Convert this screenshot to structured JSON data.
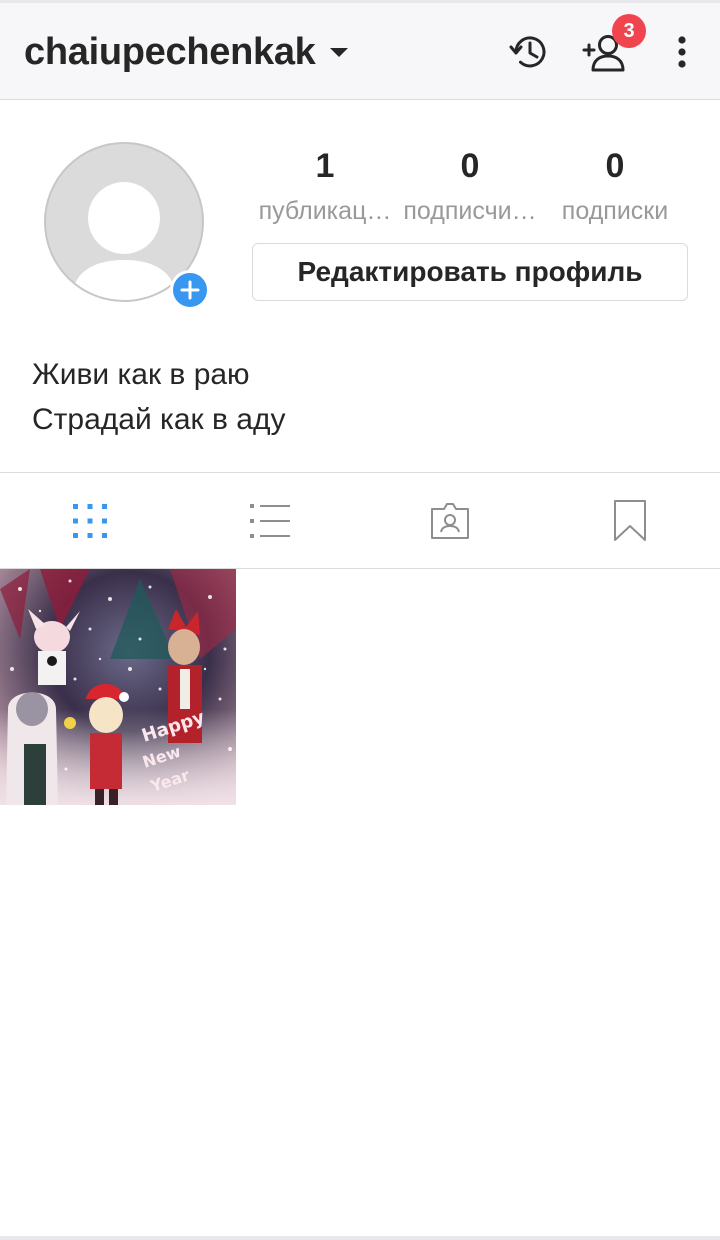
{
  "header": {
    "username": "chaiupechenkak",
    "notification_count": "3"
  },
  "profile": {
    "stats": [
      {
        "value": "1",
        "label": "публикац…"
      },
      {
        "value": "0",
        "label": "подписчи…"
      },
      {
        "value": "0",
        "label": "подписки"
      }
    ],
    "edit_button": "Редактировать профиль",
    "bio": [
      "Живи как в раю",
      "Страдай как в аду"
    ]
  },
  "tabs": [
    "grid-icon",
    "list-icon",
    "tagged-icon",
    "saved-icon"
  ],
  "active_tab": "grid",
  "posts_count": 1,
  "colors": {
    "accent": "#3897f0",
    "badge": "#f0454f",
    "text": "#262626",
    "secondary_text": "#999999",
    "divider": "#dbdbdb"
  }
}
